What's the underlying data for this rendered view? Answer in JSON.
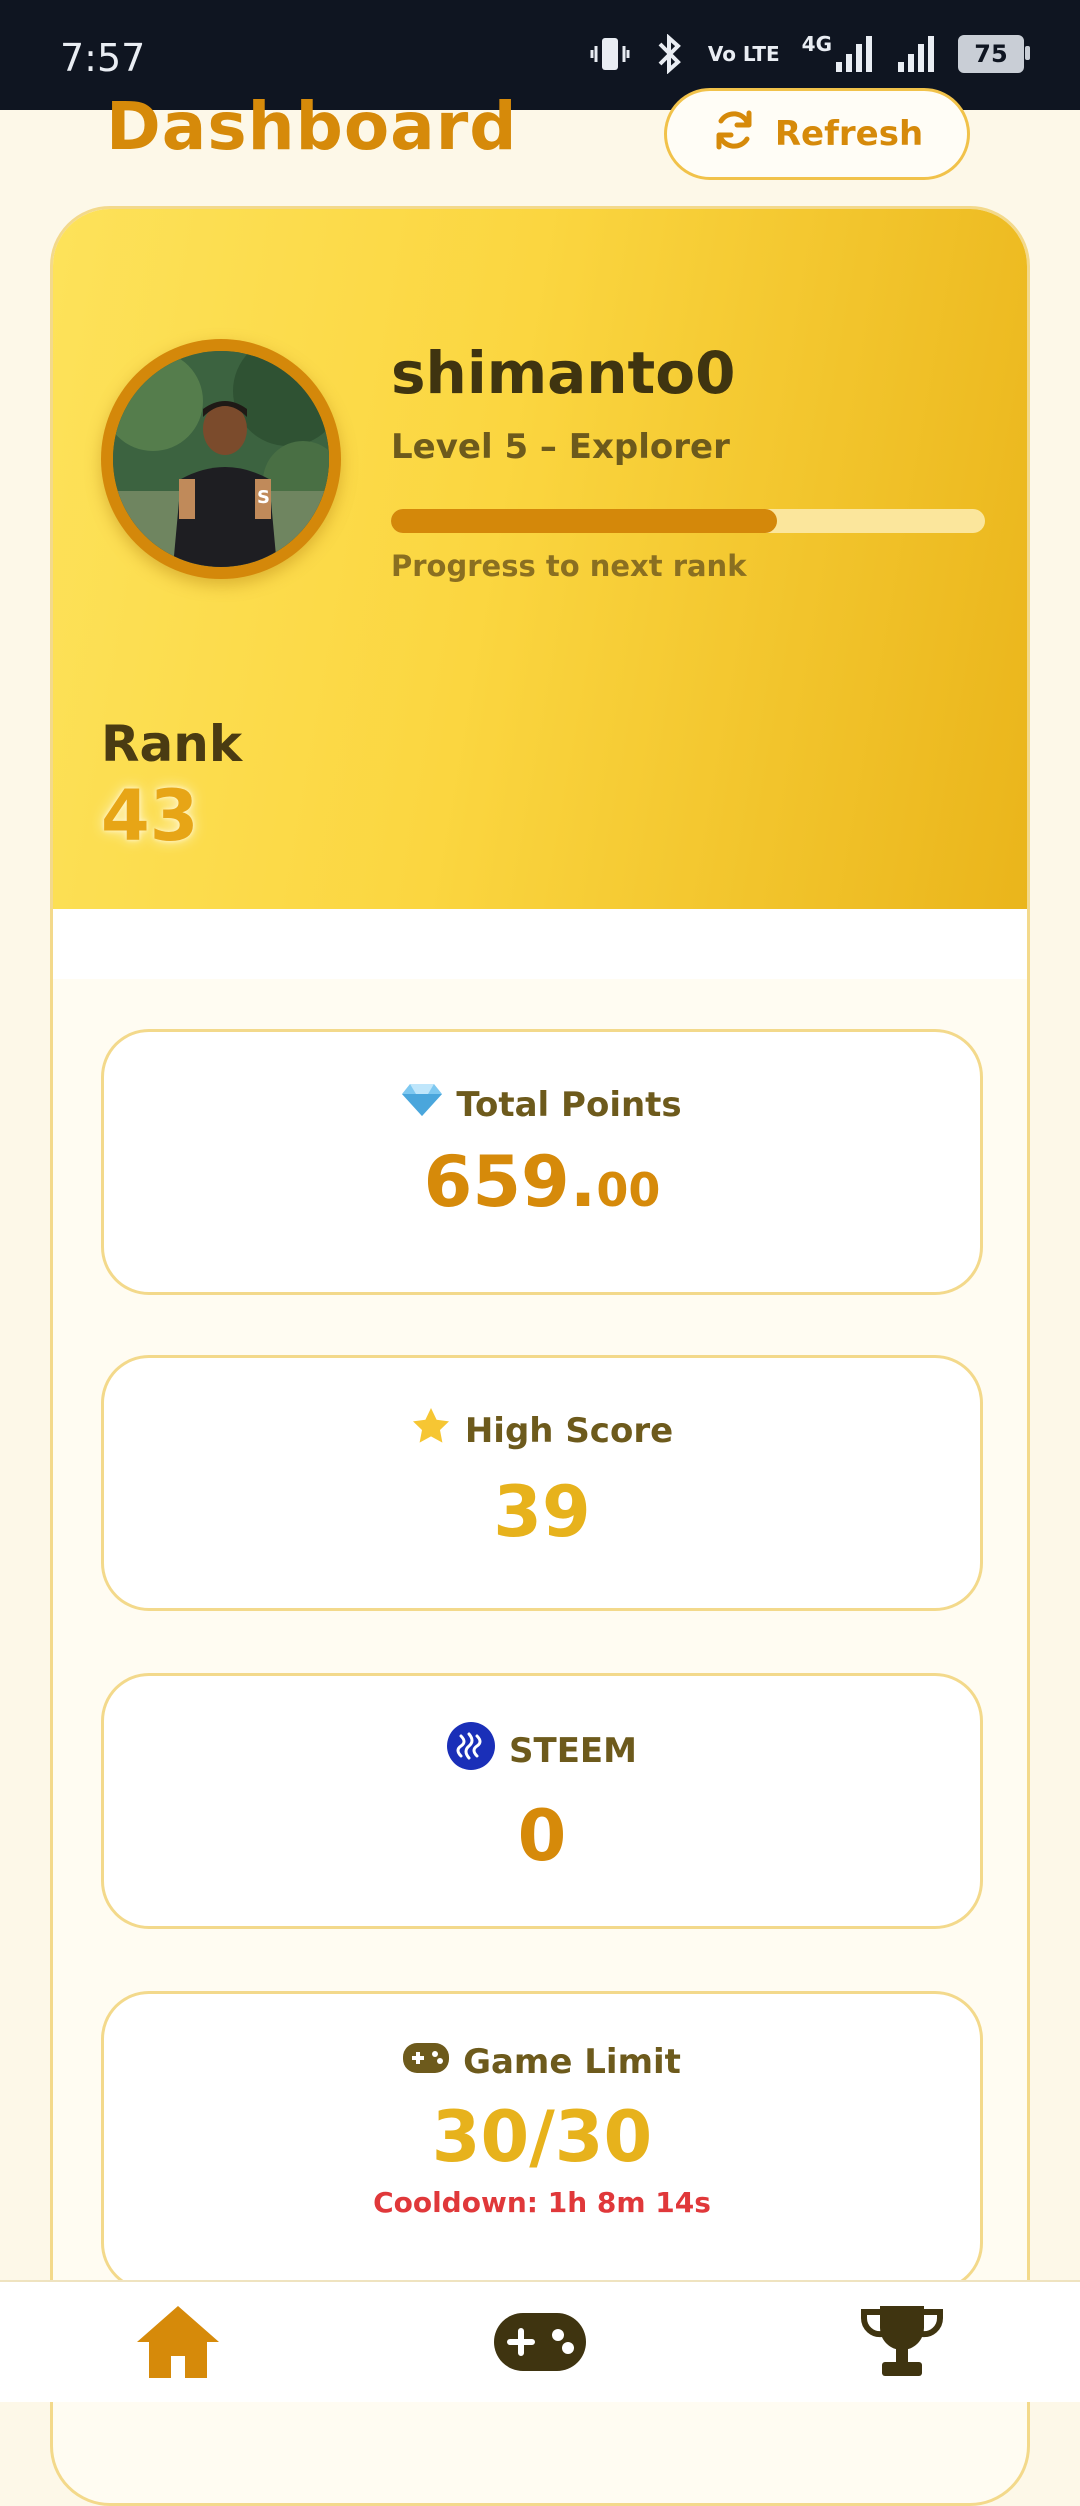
{
  "status_bar": {
    "time": "7:57",
    "network_tag_1": "Vo LTE",
    "network_tag_2": "4G",
    "battery": "75",
    "icons": [
      "vibrate-icon",
      "bluetooth-icon",
      "volte-icon",
      "signal-4g-icon",
      "signal-icon",
      "battery-icon"
    ]
  },
  "header": {
    "title": "Dashboard",
    "refresh_label": "Refresh"
  },
  "profile": {
    "username": "shimanto0",
    "level": "Level 5 – Explorer",
    "progress_fraction": 0.65,
    "progress_label": "Progress to next rank",
    "rank_label": "Rank",
    "rank_value": "43"
  },
  "stats": {
    "total_points": {
      "label": "Total Points",
      "value_int": "659.",
      "value_dec": "00",
      "icon": "diamond-icon"
    },
    "high_score": {
      "label": "High Score",
      "value": "39",
      "icon": "star-icon"
    },
    "steem": {
      "label": "STEEM",
      "value": "0",
      "icon": "steem-logo-icon"
    },
    "game_limit": {
      "label": "Game Limit",
      "value": "30/30",
      "cooldown": "Cooldown: 1h 8m 14s",
      "icon": "gamepad-icon"
    }
  },
  "colors": {
    "accent": "#d68a0a",
    "gold": "#e7b21c",
    "hero_start": "#fde25a",
    "hero_end": "#eab51b",
    "cooldown_red": "#e0383a",
    "nav_dark": "#3f3410"
  },
  "bottom_nav": [
    {
      "name": "home",
      "icon": "home-icon",
      "active": true
    },
    {
      "name": "games",
      "icon": "gamepad-icon",
      "active": false
    },
    {
      "name": "leaderboard",
      "icon": "trophy-icon",
      "active": false
    }
  ]
}
